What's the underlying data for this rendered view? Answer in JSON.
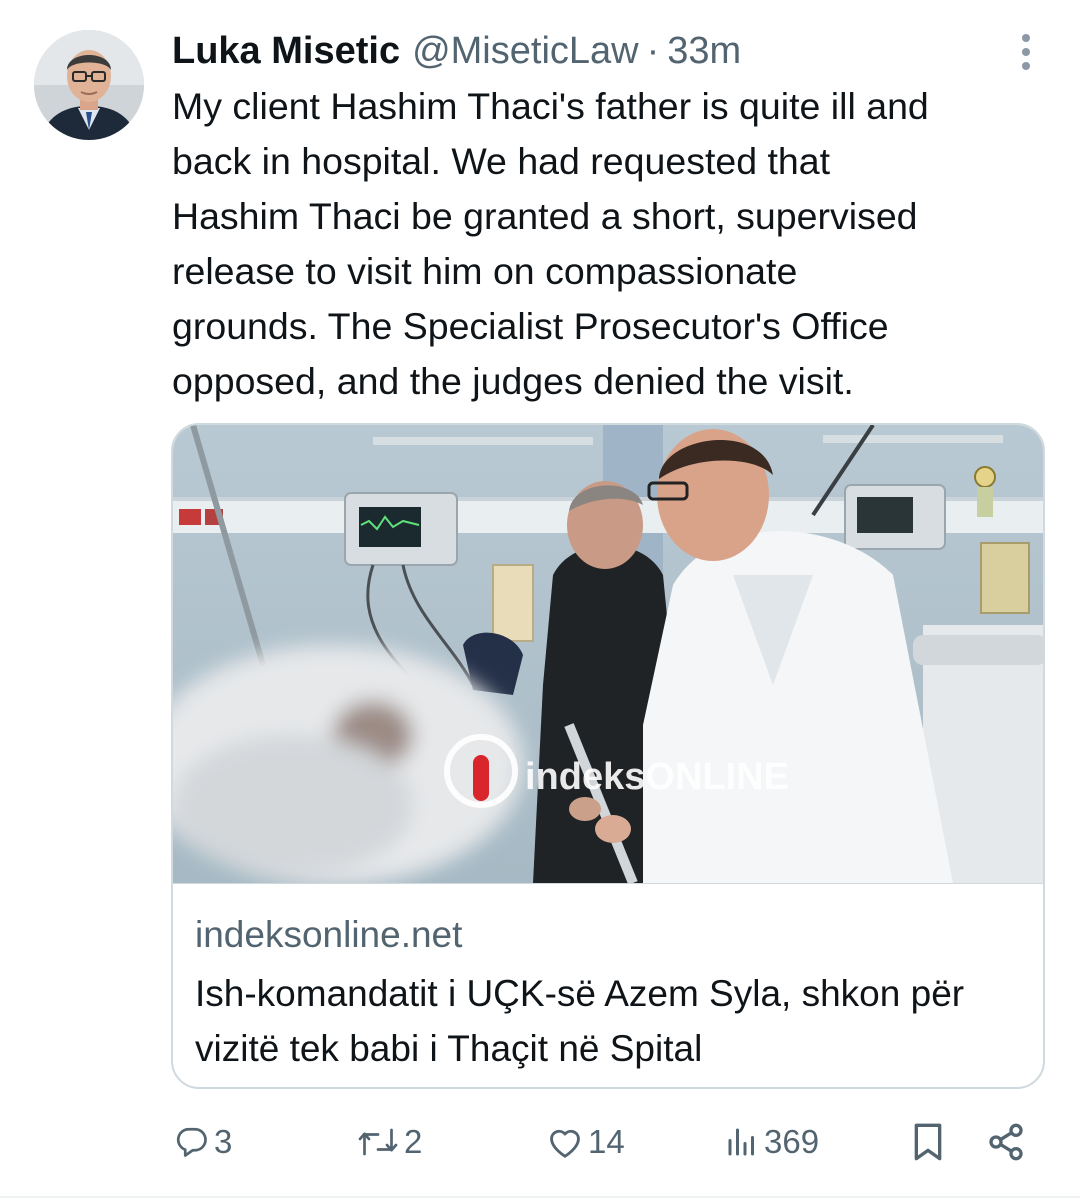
{
  "tweet": {
    "display_name": "Luka Misetic",
    "handle": "@MiseticLaw",
    "separator": "·",
    "time": "33m",
    "text": "My client Hashim Thaci's father is quite ill and\nback in hospital. We had requested that\nHashim Thaci be granted a short, supervised\nrelease to visit him on compassionate\ngrounds. The Specialist Prosecutor's Office\nopposed, and the judges denied the visit.",
    "avatar_icon": "profile-photo"
  },
  "card": {
    "domain": "indeksonline.net",
    "title": "Ish-komandatit i UÇK-së Azem Syla, shkon për vizitë tek babi i Thaçit në Spital",
    "watermark": "indeksONLINE"
  },
  "actions": {
    "reply": {
      "icon": "reply-icon",
      "count": "3"
    },
    "retweet": {
      "icon": "retweet-icon",
      "count": "2"
    },
    "like": {
      "icon": "heart-icon",
      "count": "14"
    },
    "views": {
      "icon": "views-icon",
      "count": "369"
    },
    "bookmark": {
      "icon": "bookmark-icon"
    },
    "share": {
      "icon": "share-icon"
    }
  },
  "colors": {
    "text_primary": "#0f1419",
    "text_secondary": "#536471",
    "border": "#cfd9de",
    "watermark_red": "#d8262c"
  }
}
